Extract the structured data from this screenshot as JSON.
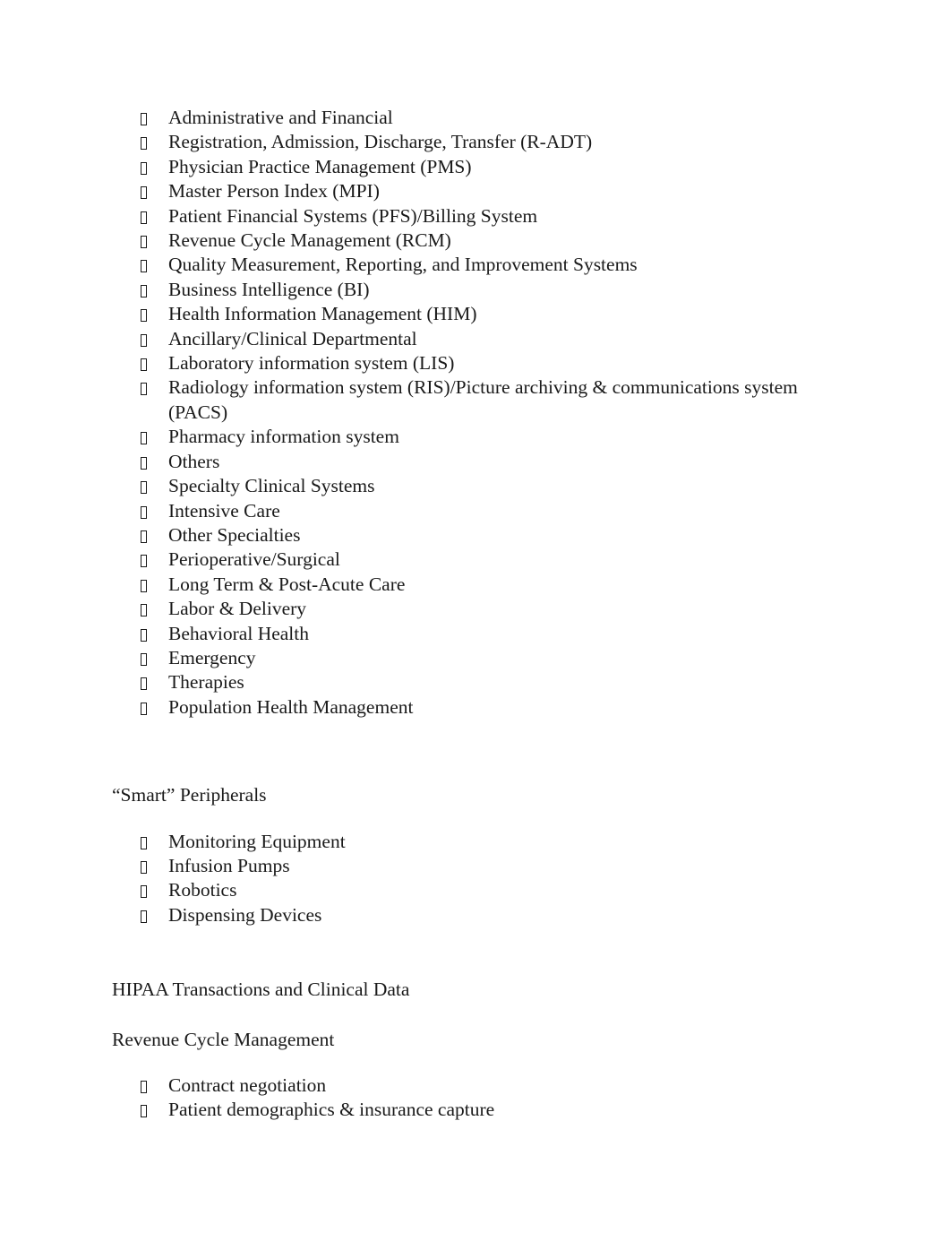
{
  "document": {
    "background_color": "#ffffff",
    "text_color": "#1a1a1a",
    "bullet_glyph_name": "missing-glyph-box"
  },
  "sections": [
    {
      "id": "systems_list",
      "heading": null,
      "items": [
        "Administrative and Financial",
        "Registration, Admission, Discharge, Transfer (R-ADT)",
        "Physician Practice Management (PMS)",
        "Master Person Index (MPI)",
        "Patient Financial Systems (PFS)/Billing System",
        "Revenue Cycle Management (RCM)",
        "Quality Measurement, Reporting, and Improvement Systems",
        "Business Intelligence (BI)",
        "Health Information Management (HIM)",
        "Ancillary/Clinical Departmental",
        "Laboratory information system (LIS)",
        "Radiology information system (RIS)/Picture archiving & communications system (PACS)",
        "Pharmacy information system",
        "Others",
        "Specialty Clinical Systems",
        "Intensive Care",
        "Other Specialties",
        "Perioperative/Surgical",
        "Long Term & Post-Acute Care",
        "Labor & Delivery",
        "Behavioral Health",
        "Emergency",
        "Therapies",
        "Population Health Management"
      ]
    },
    {
      "id": "smart_peripherals",
      "heading": "“Smart” Peripherals",
      "items": [
        "Monitoring Equipment",
        "Infusion Pumps",
        "Robotics",
        "Dispensing Devices"
      ]
    },
    {
      "id": "hipaa",
      "heading": "HIPAA Transactions and Clinical Data",
      "items": []
    },
    {
      "id": "revenue_cycle_management",
      "heading": "Revenue Cycle Management",
      "items": [
        "Contract negotiation",
        "Patient demographics & insurance capture"
      ]
    }
  ]
}
